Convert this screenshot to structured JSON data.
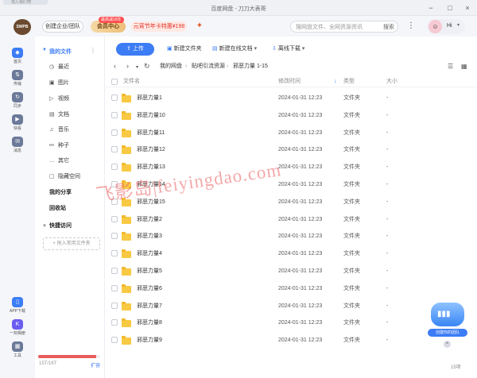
{
  "titlebar": {
    "tab_label": "加入我们吧",
    "title": "百度网盘 - 刀刀大表哥"
  },
  "header": {
    "avatar_text": "SWPB",
    "enterprise_label": "创建企业/团队",
    "vip_label": "会员中心",
    "vip_badge": "最高减18年",
    "promo_label": "元宵节年卡特惠¥198",
    "search_placeholder": "搜网盘文件、全网资源资讯",
    "search_button": "搜索",
    "user_greeting": "Hi"
  },
  "leftbar": {
    "items": [
      {
        "label": "首页"
      },
      {
        "label": "传输"
      },
      {
        "label": "同步"
      },
      {
        "label": "快看"
      },
      {
        "label": "消息"
      },
      {
        "label": "APP下载"
      },
      {
        "label": "一刻相册"
      },
      {
        "label": "工具"
      }
    ]
  },
  "sidebar": {
    "my_files": "我的文件",
    "items": [
      {
        "label": "最近",
        "icon": "clock-icon"
      },
      {
        "label": "图片",
        "icon": "image-icon"
      },
      {
        "label": "视频",
        "icon": "play-icon"
      },
      {
        "label": "文档",
        "icon": "document-icon"
      },
      {
        "label": "音乐",
        "icon": "headphone-icon"
      },
      {
        "label": "种子",
        "icon": "bt-icon"
      },
      {
        "label": "其它",
        "icon": "dots-icon"
      },
      {
        "label": "隐藏空间",
        "icon": "lock-icon"
      }
    ],
    "my_share": "我的分享",
    "recycle": "回收站",
    "quick_access": "快捷访问",
    "add_fav": "+ 拖入常用文件夹",
    "quota_text": "15T/16T",
    "quota_fraction": 0.94,
    "expand": "扩容"
  },
  "toolbar": {
    "upload": "上传",
    "new_folder": "新建文件夹",
    "new_online_doc": "新建在线文档",
    "offline_download": "离线下载"
  },
  "breadcrumb": [
    "我的网盘",
    "贴吧引流资源",
    "邪恶力量 1-15"
  ],
  "table": {
    "headers": {
      "name": "文件名",
      "modified": "修改时间",
      "type": "类型",
      "size": "大小"
    },
    "rows": [
      {
        "name": "邪恶力量1",
        "modified": "2024-01-31 12:23",
        "type": "文件夹",
        "size": "-"
      },
      {
        "name": "邪恶力量10",
        "modified": "2024-01-31 12:23",
        "type": "文件夹",
        "size": "-"
      },
      {
        "name": "邪恶力量11",
        "modified": "2024-01-31 12:23",
        "type": "文件夹",
        "size": "-"
      },
      {
        "name": "邪恶力量12",
        "modified": "2024-01-31 12:23",
        "type": "文件夹",
        "size": "-"
      },
      {
        "name": "邪恶力量13",
        "modified": "2024-01-31 12:23",
        "type": "文件夹",
        "size": "-"
      },
      {
        "name": "邪恶力量14",
        "modified": "2024-01-31 12:23",
        "type": "文件夹",
        "size": "-"
      },
      {
        "name": "邪恶力量15",
        "modified": "2024-01-31 12:23",
        "type": "文件夹",
        "size": "-"
      },
      {
        "name": "邪恶力量2",
        "modified": "2024-01-31 12:23",
        "type": "文件夹",
        "size": "-"
      },
      {
        "name": "邪恶力量3",
        "modified": "2024-01-31 12:23",
        "type": "文件夹",
        "size": "-"
      },
      {
        "name": "邪恶力量4",
        "modified": "2024-01-31 12:23",
        "type": "文件夹",
        "size": "-"
      },
      {
        "name": "邪恶力量5",
        "modified": "2024-01-31 12:23",
        "type": "文件夹",
        "size": "-"
      },
      {
        "name": "邪恶力量6",
        "modified": "2024-01-31 12:23",
        "type": "文件夹",
        "size": "-"
      },
      {
        "name": "邪恶力量7",
        "modified": "2024-01-31 12:23",
        "type": "文件夹",
        "size": "-"
      },
      {
        "name": "邪恶力量8",
        "modified": "2024-01-31 12:23",
        "type": "文件夹",
        "size": "-"
      },
      {
        "name": "邪恶力量9",
        "modified": "2024-01-31 12:23",
        "type": "文件夹",
        "size": "-"
      }
    ]
  },
  "watermark": "飞影岛|feiyingdao.com",
  "widget": {
    "label": "创建你的团队"
  },
  "footer": {
    "count": "15项"
  },
  "colors": {
    "accent": "#3c7cf5",
    "folder": "#f8c942",
    "vip_gold": "#eebf78",
    "quota_red": "#e95c5c",
    "watermark": "#ec6e6e"
  }
}
